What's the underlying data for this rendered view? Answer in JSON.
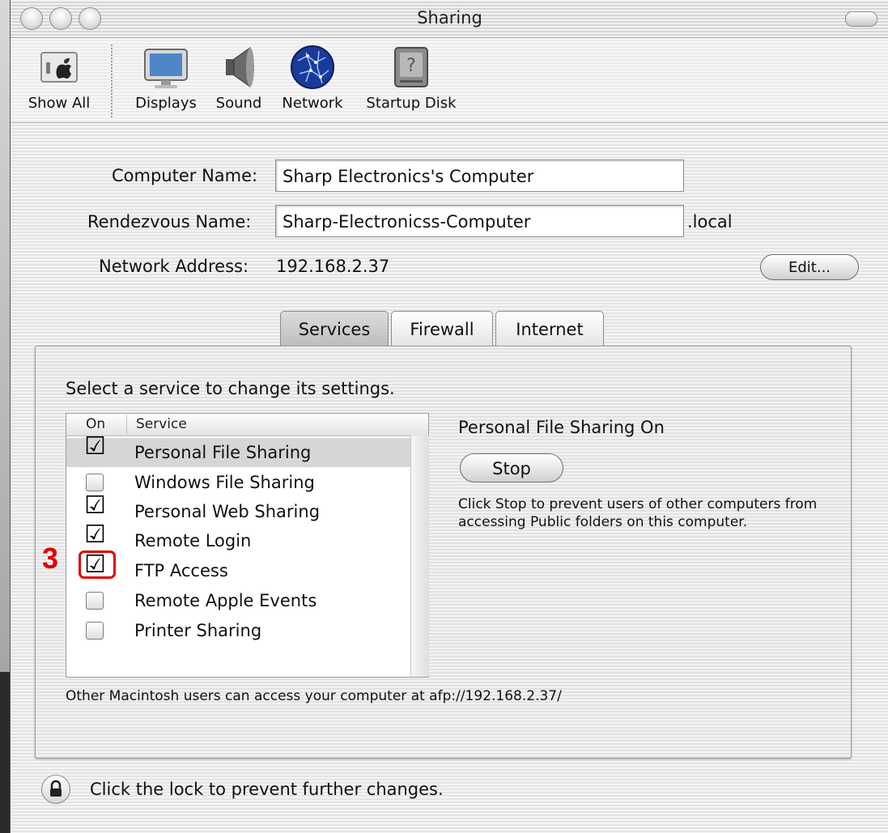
{
  "window": {
    "title": "Sharing"
  },
  "toolbar": {
    "items": [
      {
        "label": "Show All",
        "icon": "apple-icon"
      },
      {
        "label": "Displays",
        "icon": "display-icon"
      },
      {
        "label": "Sound",
        "icon": "speaker-icon"
      },
      {
        "label": "Network",
        "icon": "globe-icon"
      },
      {
        "label": "Startup Disk",
        "icon": "disk-icon"
      }
    ]
  },
  "form": {
    "computer_name_label": "Computer Name:",
    "computer_name_value": "Sharp Electronics's Computer",
    "rendezvous_label": "Rendezvous Name:",
    "rendezvous_value": "Sharp-Electronicss-Computer",
    "rendezvous_suffix": ".local",
    "network_address_label": "Network Address:",
    "network_address_value": "192.168.2.37",
    "edit_button": "Edit..."
  },
  "tabs": [
    {
      "label": "Services",
      "active": true
    },
    {
      "label": "Firewall",
      "active": false
    },
    {
      "label": "Internet",
      "active": false
    }
  ],
  "services": {
    "instruction": "Select a service to change its settings.",
    "columns": {
      "on": "On",
      "service": "Service"
    },
    "rows": [
      {
        "name": "Personal File Sharing",
        "on": true,
        "selected": true
      },
      {
        "name": "Windows File Sharing",
        "on": false,
        "selected": false
      },
      {
        "name": "Personal Web Sharing",
        "on": true,
        "selected": false
      },
      {
        "name": "Remote Login",
        "on": true,
        "selected": false
      },
      {
        "name": "FTP Access",
        "on": true,
        "selected": false
      },
      {
        "name": "Remote Apple Events",
        "on": false,
        "selected": false
      },
      {
        "name": "Printer Sharing",
        "on": false,
        "selected": false
      }
    ],
    "status_title": "Personal File Sharing On",
    "stop_button": "Stop",
    "description": "Click Stop to prevent users of other computers from accessing Public folders on this computer.",
    "afp_note": "Other Macintosh users can access your computer at afp://192.168.2.37/"
  },
  "annotation": {
    "step_number": "3",
    "color": "#e00000"
  },
  "lock": {
    "text": "Click the lock to prevent further changes."
  }
}
